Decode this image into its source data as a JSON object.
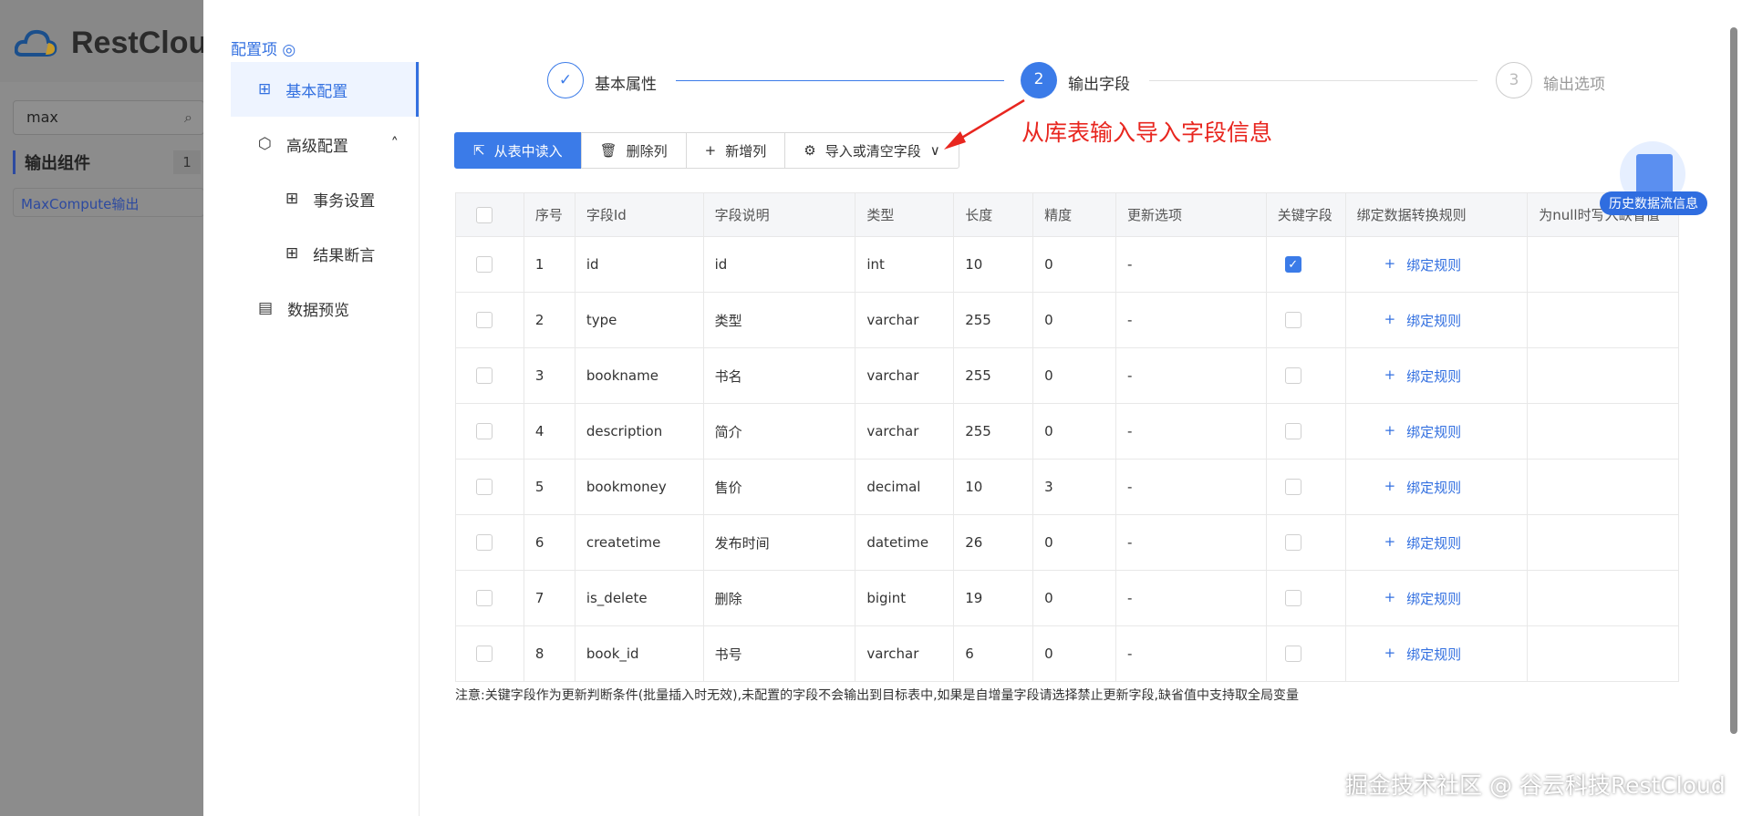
{
  "background": {
    "app_name": "RestCloud",
    "search_value": "max",
    "section_title": "输出组件",
    "section_count": "1",
    "component_item": "MaxCompute输出"
  },
  "menu": {
    "title": "配置项",
    "items": [
      {
        "label": "基本配置"
      },
      {
        "label": "高级配置"
      },
      {
        "label": "事务设置"
      },
      {
        "label": "结果断言"
      },
      {
        "label": "数据预览"
      }
    ]
  },
  "steps": [
    {
      "num": "1",
      "label": "基本属性"
    },
    {
      "num": "2",
      "label": "输出字段"
    },
    {
      "num": "3",
      "label": "输出选项"
    }
  ],
  "toolbar": {
    "read_from_table": "从表中读入",
    "delete_column": "删除列",
    "add_column": "新增列",
    "import_or_clear": "导入或清空字段"
  },
  "annotation": "从库表输入导入字段信息",
  "history_badge": "历史数据流信息",
  "table": {
    "headers": [
      "",
      "序号",
      "字段Id",
      "字段说明",
      "类型",
      "长度",
      "精度",
      "更新选项",
      "关键字段",
      "绑定数据转换规则",
      "为null时写入缺省值"
    ],
    "bind_label": "绑定规则",
    "rows": [
      {
        "no": "1",
        "id": "id",
        "desc": "id",
        "type": "int",
        "len": "10",
        "prec": "0",
        "update": "-",
        "key": true
      },
      {
        "no": "2",
        "id": "type",
        "desc": "类型",
        "type": "varchar",
        "len": "255",
        "prec": "0",
        "update": "-",
        "key": false
      },
      {
        "no": "3",
        "id": "bookname",
        "desc": "书名",
        "type": "varchar",
        "len": "255",
        "prec": "0",
        "update": "-",
        "key": false
      },
      {
        "no": "4",
        "id": "description",
        "desc": "简介",
        "type": "varchar",
        "len": "255",
        "prec": "0",
        "update": "-",
        "key": false
      },
      {
        "no": "5",
        "id": "bookmoney",
        "desc": "售价",
        "type": "decimal",
        "len": "10",
        "prec": "3",
        "update": "-",
        "key": false
      },
      {
        "no": "6",
        "id": "createtime",
        "desc": "发布时间",
        "type": "datetime",
        "len": "26",
        "prec": "0",
        "update": "-",
        "key": false
      },
      {
        "no": "7",
        "id": "is_delete",
        "desc": "删除",
        "type": "bigint",
        "len": "19",
        "prec": "0",
        "update": "-",
        "key": false
      },
      {
        "no": "8",
        "id": "book_id",
        "desc": "书号",
        "type": "varchar",
        "len": "6",
        "prec": "0",
        "update": "-",
        "key": false
      }
    ]
  },
  "note": "注意:关键字段作为更新判断条件(批量插入时无效),未配置的字段不会输出到目标表中,如果是自增量字段请选择禁止更新字段,缺省值中支持取全局变量",
  "watermark": "掘金技术社区 @ 谷云科技RestCloud",
  "colors": {
    "primary": "#3b7be8",
    "annotation": "#e8261f"
  }
}
